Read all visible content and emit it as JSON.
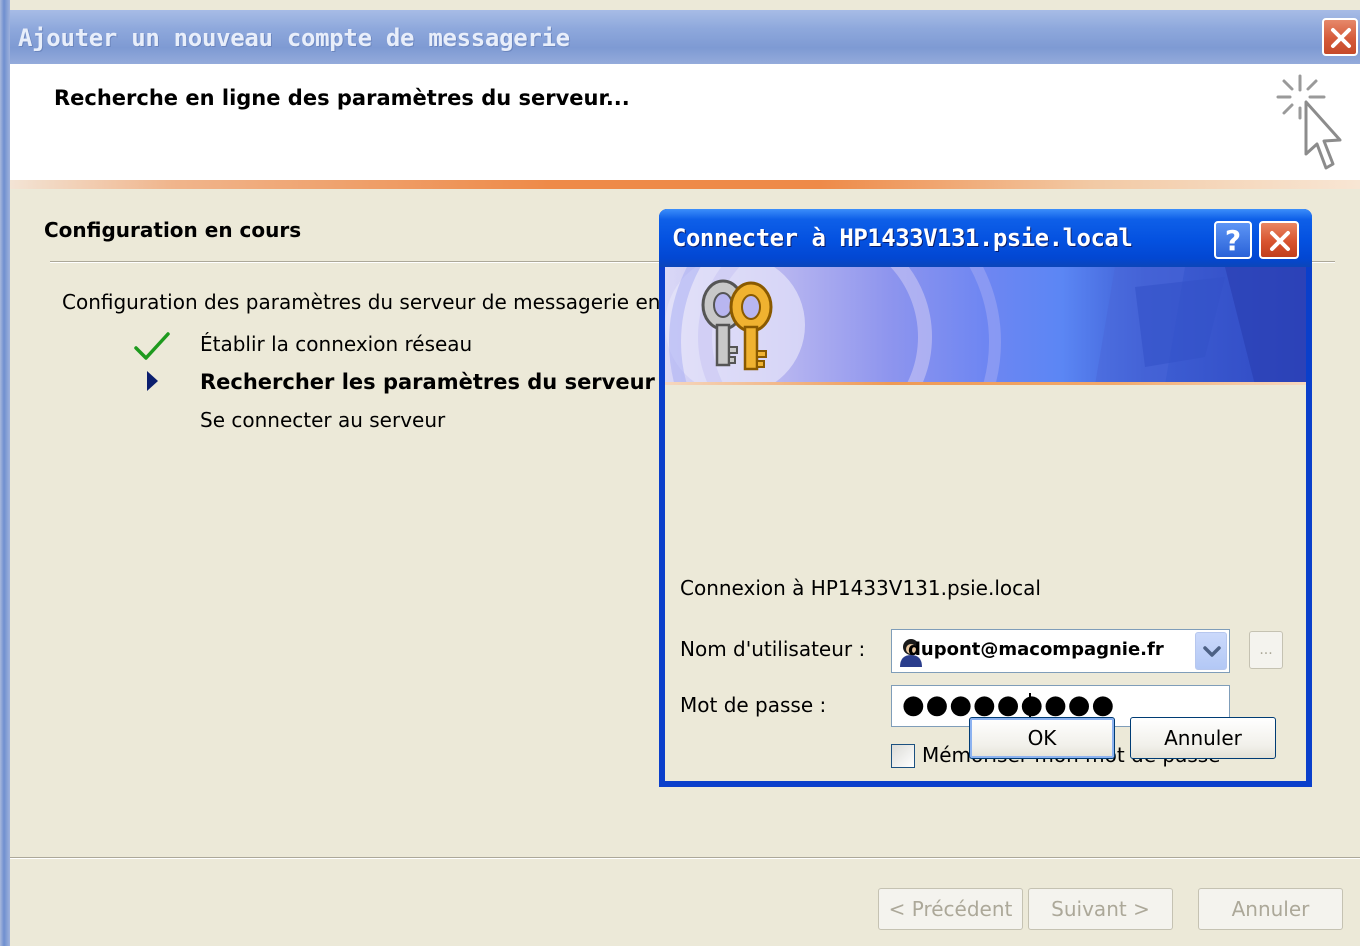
{
  "wizard": {
    "title": "Ajouter un nouveau compte de messagerie",
    "subtitle": "Recherche en ligne des paramètres du serveur...",
    "section_title": "Configuration en cours",
    "description": "Configuration des paramètres du serveur de messagerie en co",
    "steps": [
      {
        "label": "Établir la connexion réseau",
        "status": "done"
      },
      {
        "label": "Rechercher les paramètres du serveur lt",
        "status": "current"
      },
      {
        "label": "Se connecter au serveur",
        "status": "pending"
      }
    ],
    "buttons": {
      "previous": "< Précédent",
      "next": "Suivant >",
      "cancel": "Annuler"
    }
  },
  "dialog": {
    "title": "Connecter à HP1433V131.psie.local",
    "help_glyph": "?",
    "info": "Connexion à HP1433V131.psie.local",
    "username_label": "Nom d'utilisateur :",
    "username_value": "dupont@macompagnie.fr",
    "password_label": "Mot de passe :",
    "password_value": "●●●●●●●●●",
    "remember_label": "Mémoriser mon mot de passe",
    "remember_checked": false,
    "browse_label": "...",
    "ok_label": "OK",
    "cancel_label": "Annuler"
  },
  "icons": [
    "close-icon",
    "cursor-sparkle-icon",
    "checkmark-icon",
    "arrow-right-icon",
    "help-icon",
    "keys-icon",
    "user-icon",
    "chevron-down-icon"
  ],
  "colors": {
    "dialog_frame": "#0A3FCB",
    "title_accent": "#0451E0",
    "header_stripe": "#EE8A48",
    "check_green": "#1E9A1E",
    "arrow_navy": "#0B1E6E"
  }
}
